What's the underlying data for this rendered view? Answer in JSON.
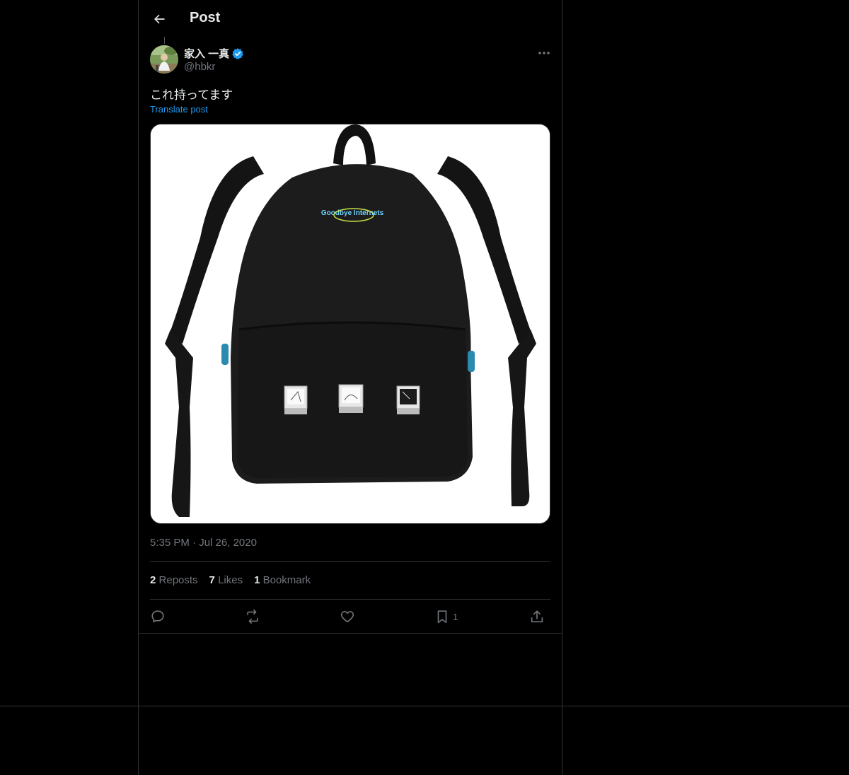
{
  "header": {
    "title": "Post"
  },
  "author": {
    "display_name": "家入 一真",
    "handle": "@hbkr",
    "verified": true
  },
  "post": {
    "text": "これ持ってます",
    "translate_label": "Translate post",
    "time": "5:35 PM",
    "separator": "·",
    "date": "Jul 26, 2020",
    "media_text": "Goodbye Internets"
  },
  "stats": {
    "reposts_count": "2",
    "reposts_label": "Reposts",
    "likes_count": "7",
    "likes_label": "Likes",
    "bookmarks_count": "1",
    "bookmarks_label": "Bookmark"
  },
  "actions": {
    "reply": "reply-icon",
    "repost": "repost-icon",
    "like": "heart-icon",
    "bookmark": "bookmark-icon",
    "bookmark_count": "1",
    "share": "share-icon"
  },
  "colors": {
    "background": "#000000",
    "text": "#e7e9ea",
    "muted": "#71767b",
    "accent": "#1d9bf0",
    "border": "#2f3336"
  }
}
